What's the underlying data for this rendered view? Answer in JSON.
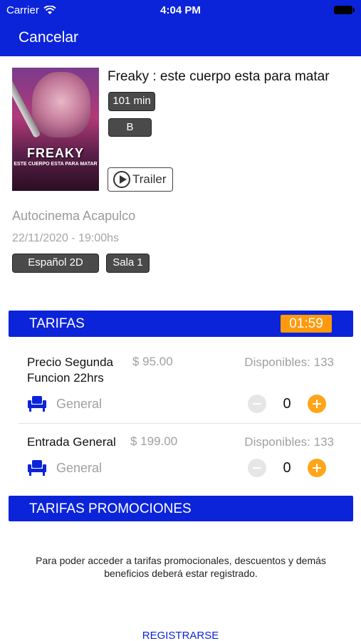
{
  "status_bar": {
    "carrier": "Carrier",
    "time": "4:04 PM"
  },
  "nav": {
    "cancel_label": "Cancelar"
  },
  "movie": {
    "title": "Freaky : este cuerpo esta para matar",
    "duration": "101 min",
    "rating": "B",
    "trailer_label": "Trailer",
    "poster": {
      "title": "FREAKY",
      "subtitle": "ESTE CUERPO ESTA PARA MATAR"
    }
  },
  "showing": {
    "venue": "Autocinema Acapulco",
    "datetime": "22/11/2020 - 19:00hs",
    "language": "Español 2D",
    "room": "Sala 1"
  },
  "tarifas": {
    "title": "TARIFAS",
    "timer": "01:59",
    "rates": [
      {
        "name_line1": "Precio Segunda",
        "name_line2": "Funcion 22hrs",
        "price": "$ 95.00",
        "available": "Disponibles: 133",
        "seat_type": "General",
        "quantity": "0"
      },
      {
        "name_line1": "Entrada General",
        "price": "$ 199.00",
        "available": "Disponibles: 133",
        "seat_type": "General",
        "quantity": "0"
      }
    ]
  },
  "promociones": {
    "title": "TARIFAS PROMOCIONES",
    "message": "Para poder acceder a tarifas promocionales, descuentos y demás beneficios deberá estar registrado.",
    "register_label": "REGISTRARSE"
  },
  "colors": {
    "primary": "#0b24d9",
    "accent": "#ff9a0d",
    "muted_text": "#a0a0a0"
  }
}
